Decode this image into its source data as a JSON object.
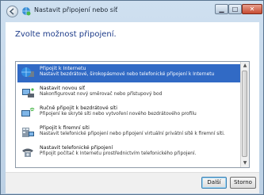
{
  "window": {
    "title": "Nastavit připojení nebo síť",
    "controls": {
      "minimize": "▁",
      "maximize": "□",
      "close": "✕"
    }
  },
  "main": {
    "heading": "Zvolte možnost připojení.",
    "options": [
      {
        "title": "Připojit k Internetu",
        "description": "Nastavit bezdrátové, širokopásmové nebo telefonické připojení k Internetu",
        "icon": "globe-network-icon",
        "selected": true
      },
      {
        "title": "Nastavit novou síť",
        "description": "Nakonfigurovat nový směrovač nebo přístupový bod",
        "icon": "router-icon",
        "selected": false
      },
      {
        "title": "Ručně připojit k bezdrátové síti",
        "description": "Připojení ke skryté síti nebo vytvoření nového bezdrátového profilu",
        "icon": "wireless-network-icon",
        "selected": false
      },
      {
        "title": "Připojit k firemní síti",
        "description": "Nastavit telefonické připojení nebo připojení virtuální privátní sítě k firemní síti.",
        "icon": "workplace-network-icon",
        "selected": false
      },
      {
        "title": "Nastavit telefonické připojení",
        "description": "Připojit počítač k Internetu prostřednictvím telefonického připojení.",
        "icon": "dialup-phone-icon",
        "selected": false
      }
    ]
  },
  "footer": {
    "next_label": "Další",
    "cancel_label": "Storno"
  },
  "colors": {
    "selection": "#316ac5",
    "heading": "#1e3c8a"
  }
}
